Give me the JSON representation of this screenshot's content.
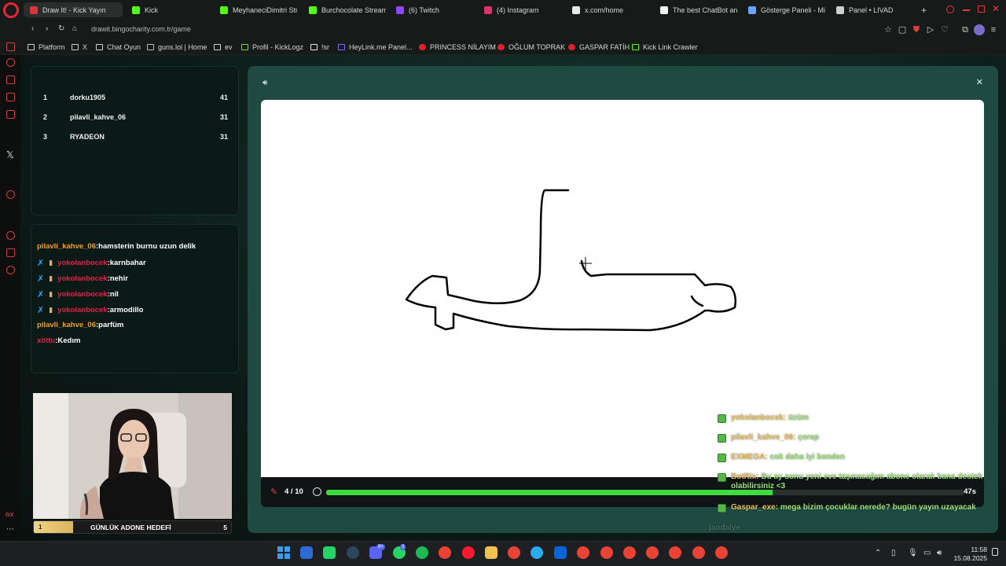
{
  "browser": {
    "tabs": [
      {
        "label": "Draw It! - Kick Yayın",
        "active": true,
        "favicon_color": "#d9333f"
      },
      {
        "label": "Kick",
        "favicon_color": "#53fc18"
      },
      {
        "label": "MeyhaneciDimitri Str",
        "favicon_color": "#53fc18"
      },
      {
        "label": "Burchocolate Stream",
        "favicon_color": "#53fc18"
      },
      {
        "label": "(6) Twitch",
        "favicon_color": "#9146ff"
      },
      {
        "label": "(4) Instagram",
        "favicon_color": "#e1306c"
      },
      {
        "label": "x.com/home",
        "favicon_color": "#e8e8e8"
      },
      {
        "label": "The best ChatBot an",
        "favicon_color": "#f2f2f2"
      },
      {
        "label": "Gösterge Paneli - Mi",
        "favicon_color": "#6aa3ff"
      },
      {
        "label": "Panel • LIVAD",
        "favicon_color": "#cfcfcf"
      }
    ],
    "new_tab": "+",
    "url": "drawit.bingocharity.com.tr/game",
    "toolbar_icons": [
      "bookmark-icon",
      "screenshot-icon",
      "shield-icon",
      "pocket-icon",
      "play-icon",
      "heart-icon",
      "extensions-icon",
      "profile-icon",
      "menu-icon"
    ],
    "bookmarks": [
      {
        "label": "Platform",
        "icon": "folder-icon"
      },
      {
        "label": "X",
        "icon": "folder-icon"
      },
      {
        "label": "Chat Oyun",
        "icon": "folder-icon"
      },
      {
        "label": "guns.lol | Home",
        "icon": "guns-icon"
      },
      {
        "label": "ev",
        "icon": "folder-icon"
      },
      {
        "label": "Profil - KickLogz",
        "icon": "kick-icon"
      },
      {
        "label": "!sr",
        "icon": "sr-icon"
      },
      {
        "label": "HeyLink.me Panel...",
        "icon": "heylink-icon"
      },
      {
        "label": "PRINCESS NİLAYIM",
        "icon": "heart-icon"
      },
      {
        "label": "OĞLUM TOPRAK",
        "icon": "heart-icon"
      },
      {
        "label": "GASPAR FATİH",
        "icon": "heart-icon"
      },
      {
        "label": "Kick Link Crawler",
        "icon": "kick-icon"
      }
    ]
  },
  "leaderboard": [
    {
      "rank": "1",
      "name": "dorku1905",
      "score": "41"
    },
    {
      "rank": "2",
      "name": "pilavli_kahve_06",
      "score": "31"
    },
    {
      "rank": "3",
      "name": "RYADEON",
      "score": "31"
    }
  ],
  "chat": [
    {
      "user": "pilavli_kahve_06",
      "message": "hamsterin burnu uzun delik",
      "user_color": "#f0a020",
      "badges": false
    },
    {
      "user": "yokolanbocek",
      "message": "karnbahar",
      "user_color": "#e0204a",
      "badges": true
    },
    {
      "user": "yokolanbocek",
      "message": "nehir",
      "user_color": "#e0204a",
      "badges": true
    },
    {
      "user": "yokolanbocek",
      "message": "nil",
      "user_color": "#e0204a",
      "badges": true
    },
    {
      "user": "yokolanbocek",
      "message": "armodillo",
      "user_color": "#e0204a",
      "badges": true
    },
    {
      "user": "pilavli_kahve_06",
      "message": "parfüm",
      "user_color": "#f0a020",
      "badges": false
    },
    {
      "user": "xöttu",
      "message": "Kedım",
      "user_color": "#e0204a",
      "badges": false
    }
  ],
  "goal": {
    "current": "1",
    "label": "GÜNLÜK ADONE HEDEFİ",
    "target": "5",
    "progress": 0.2
  },
  "game": {
    "round": "4 / 10",
    "timer": "47s",
    "progress": 0.7,
    "sound_icon": "speaker-icon",
    "close_icon": "close-icon",
    "pencil_icon": "pencil-icon",
    "timer_icon": "stopwatch-icon"
  },
  "overlay_chat": [
    {
      "user": "yokolanbocek",
      "message": "üzüm",
      "user_color": "#e8c060",
      "msg_color": "#9ee07a"
    },
    {
      "user": "pilavli_kahve_06",
      "message": "çorap",
      "user_color": "#e8c060",
      "msg_color": "#9ee07a"
    },
    {
      "user": "EXMEGA",
      "message": "cok daha iyi benden",
      "user_color": "#e8c060",
      "msg_color": "#9ee07a"
    },
    {
      "user": "BotRix",
      "message": "Bu ay sonu yeni eve taşınacağım abone olarak bana destek olabilirsiniz <3",
      "user_color": "#e8c060",
      "msg_color": "#9ee07a"
    },
    {
      "user": "Gaspar_exe",
      "message": "mega bizim çocuklar nerede? bugün yayın uzayacak",
      "user_color": "#e8c060",
      "msg_color": "#9ee07a"
    },
    {
      "user": "",
      "message": "jandalye",
      "user_color": "#e8c060",
      "msg_color": "#4e6a62"
    }
  ],
  "taskbar": {
    "time": "11:58",
    "date": "15.08.2025",
    "apps": [
      "windows-icon",
      "bitwarden-icon",
      "whatsapp-web-icon",
      "steam-icon",
      "discord-icon",
      "whatsapp-icon",
      "spotify-icon",
      "chrome-icon",
      "opera-gx-icon",
      "files-icon",
      "chrome-icon",
      "telegram-icon",
      "outlook-icon",
      "chrome-icon",
      "chrome-icon",
      "chrome-icon",
      "chrome-icon",
      "chrome-icon",
      "chrome-icon",
      "chrome-icon"
    ],
    "app_colors": [
      "#3a9cf0",
      "#2c6bd6",
      "#25d366",
      "#2a475e",
      "#5865f2",
      "#25d366",
      "#1db954",
      "#ea4335",
      "#ff1b2d",
      "#f2c14e",
      "#ea4335",
      "#2aabee",
      "#0a64d8",
      "#ea4335",
      "#ea4335",
      "#ea4335",
      "#ea4335",
      "#ea4335",
      "#ea4335",
      "#ea4335"
    ],
    "discord_badge": "9+",
    "whatsapp_badge": "3"
  }
}
